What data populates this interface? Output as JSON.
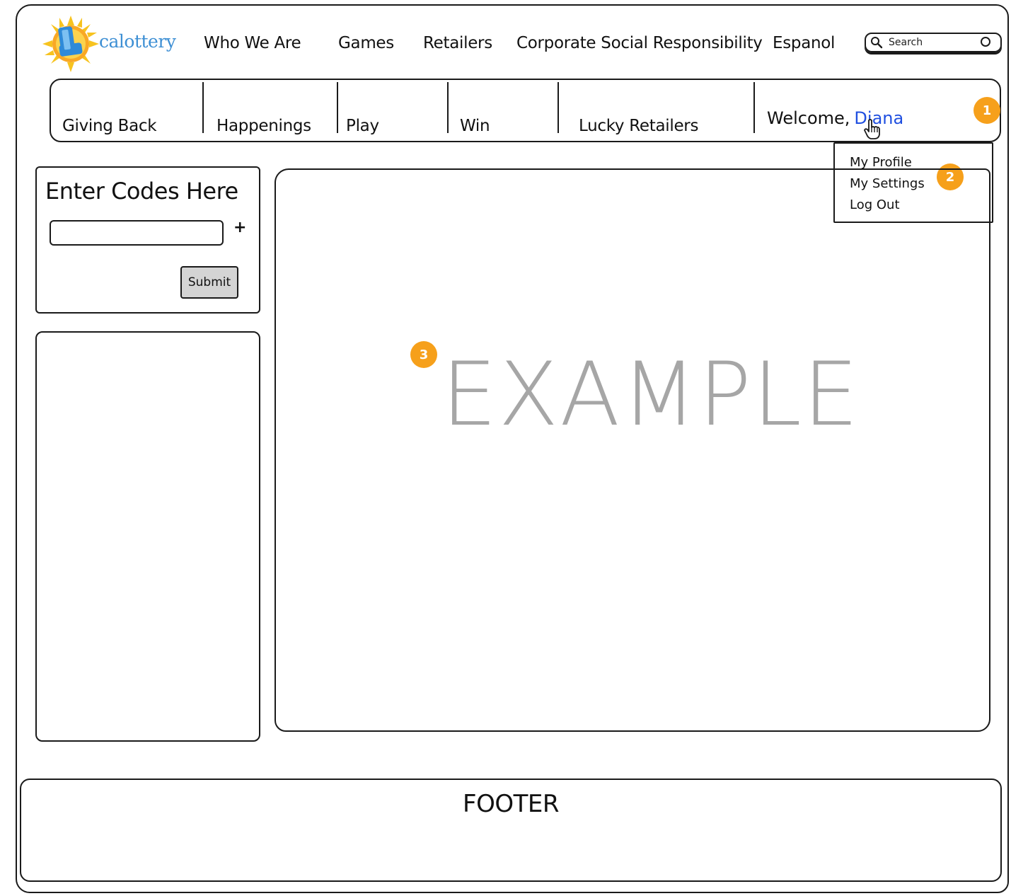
{
  "logo": {
    "text": "calottery",
    "mark": "sun-logo-icon"
  },
  "top_nav": {
    "items": [
      "Who We Are",
      "Games",
      "Retailers",
      "Corporate Social Responsibility",
      "Espanol"
    ]
  },
  "search": {
    "placeholder": "Search"
  },
  "sub_nav": {
    "items": [
      "Giving Back",
      "Happenings",
      "Play",
      "Win",
      "Lucky Retailers"
    ]
  },
  "user": {
    "welcome": "Welcome,",
    "name": "Diana"
  },
  "user_menu": {
    "items": [
      "My Profile",
      "My Settings",
      "Log Out"
    ]
  },
  "annotations": [
    "1",
    "2",
    "3"
  ],
  "codes_panel": {
    "title": "Enter Codes Here",
    "input_value": "",
    "add_label": "+",
    "submit_label": "Submit"
  },
  "main": {
    "placeholder_text": "EXAMPLE"
  },
  "footer": {
    "label": "FOOTER"
  },
  "colors": {
    "link": "#1f4fe0",
    "badge": "#f6a01b",
    "placeholder_text": "#a6a6a6",
    "logo_text": "#3d8fd4",
    "sun": "#f7c31f",
    "logo_tile": "#2f8ad8"
  }
}
